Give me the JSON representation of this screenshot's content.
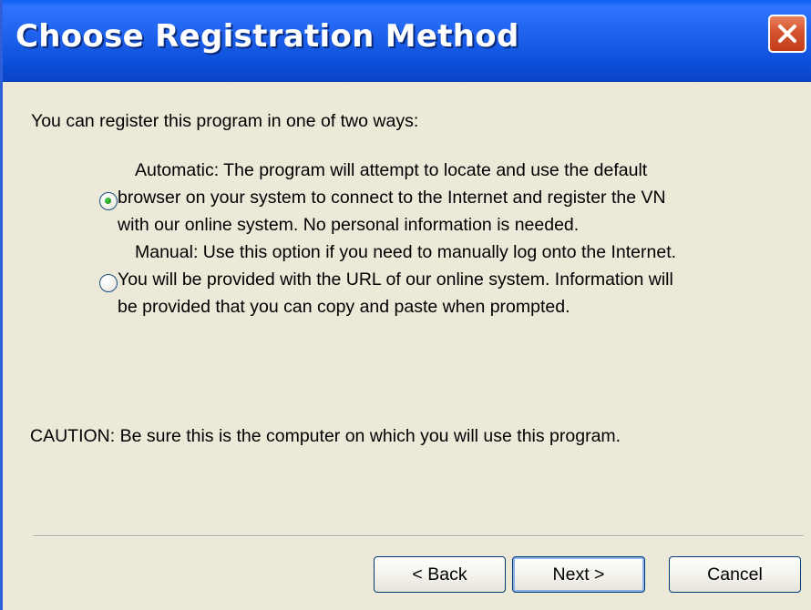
{
  "window": {
    "title": "Choose Registration Method",
    "close_label": "Close"
  },
  "intro": "You can register this program in one of two ways:",
  "options": [
    {
      "lines": [
        "Automatic:  The program will attempt to locate and use the default",
        "browser on your system to connect to the Internet and register the VN",
        "with our online system.  No personal information is needed."
      ],
      "selected": true
    },
    {
      "lines": [
        "Manual:  Use this option if you need to manually log onto the Internet.",
        "You will be provided with the URL of our online system.  Information will",
        "be provided that you can copy and paste when prompted."
      ],
      "selected": false
    }
  ],
  "caution": "CAUTION: Be sure this is the computer on which you will use this program.",
  "buttons": {
    "back": "< Back",
    "next": "Next >",
    "cancel": "Cancel"
  },
  "colors": {
    "titlebar": "#0b4fd9",
    "dialog_background": "#ece9d8",
    "close_button": "#d4532e",
    "radio_selected_dot": "#21a121",
    "default_button_focus": "#8db2ea"
  }
}
